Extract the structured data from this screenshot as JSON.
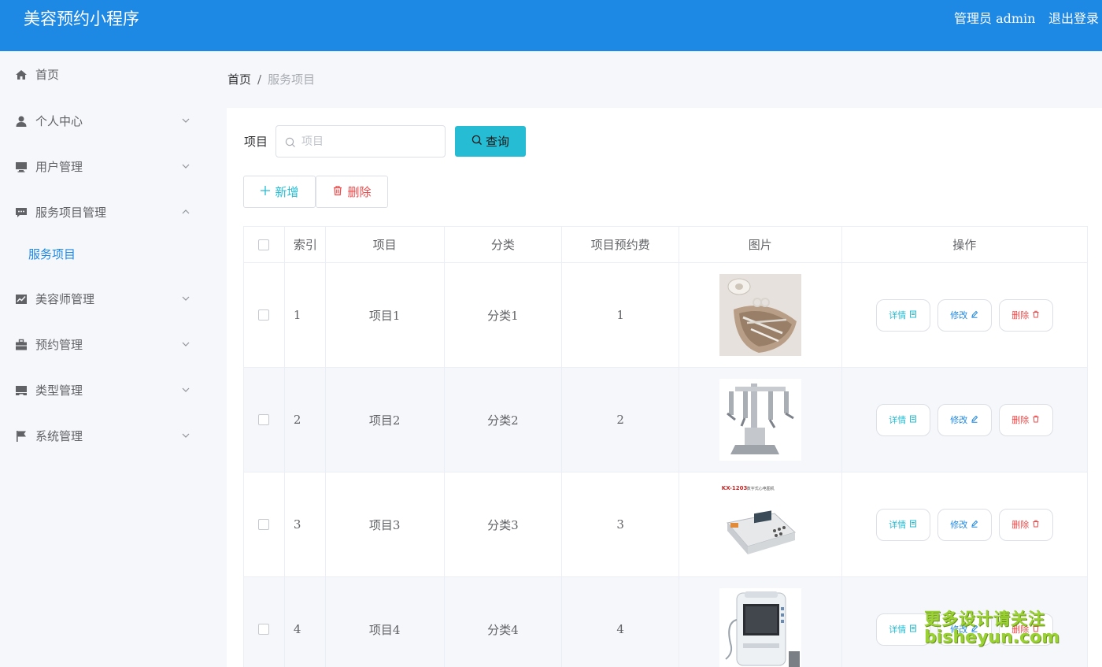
{
  "header": {
    "title": "美容预约小程序",
    "user_label": "管理员 admin",
    "logout_label": "退出登录",
    "color": "#1e88e5"
  },
  "sidebar": {
    "items": [
      {
        "label": "首页",
        "icon": "home-icon",
        "expandable": false
      },
      {
        "label": "个人中心",
        "icon": "user-icon",
        "expandable": true
      },
      {
        "label": "用户管理",
        "icon": "monitor-icon",
        "expandable": true
      },
      {
        "label": "服务项目管理",
        "icon": "chat-icon",
        "expandable": true,
        "expanded": true
      },
      {
        "label": "美容师管理",
        "icon": "trend-chart-icon",
        "expandable": true
      },
      {
        "label": "预约管理",
        "icon": "briefcase-icon",
        "expandable": true
      },
      {
        "label": "类型管理",
        "icon": "tray-icon",
        "expandable": true
      },
      {
        "label": "系统管理",
        "icon": "flag-icon",
        "expandable": true
      }
    ],
    "submenu": {
      "label": "服务项目",
      "active": true
    }
  },
  "breadcrumb": {
    "home": "首页",
    "separator": "/",
    "current": "服务项目"
  },
  "search": {
    "label": "项目",
    "placeholder": "项目",
    "value": "",
    "button_label": "查询"
  },
  "toolbar": {
    "add_label": "新增",
    "delete_label": "删除"
  },
  "table": {
    "headers": [
      "索引",
      "项目",
      "分类",
      "项目预约费",
      "图片",
      "操作"
    ],
    "rows": [
      {
        "index": "1",
        "item": "项目1",
        "category": "分类1",
        "fee": "1",
        "image": "surgical-instruments-image"
      },
      {
        "index": "2",
        "item": "项目2",
        "category": "分类2",
        "fee": "2",
        "image": "robotic-surgery-system-image"
      },
      {
        "index": "3",
        "item": "项目3",
        "category": "分类3",
        "fee": "3",
        "image": "ecg-machine-image",
        "image_caption_brand": "KX-1203",
        "image_caption_text": "数字式心电图机"
      },
      {
        "index": "4",
        "item": "项目4",
        "category": "分类4",
        "fee": "4",
        "image": "patient-monitor-image"
      }
    ],
    "actions": {
      "detail": "详情",
      "edit": "修改",
      "delete": "删除"
    }
  },
  "watermark": {
    "line1": "更多设计请关注",
    "line2": "bisheyun.com"
  },
  "colors": {
    "accent": "#26bcd3",
    "primary": "#1e88e5",
    "danger": "#f04848"
  }
}
